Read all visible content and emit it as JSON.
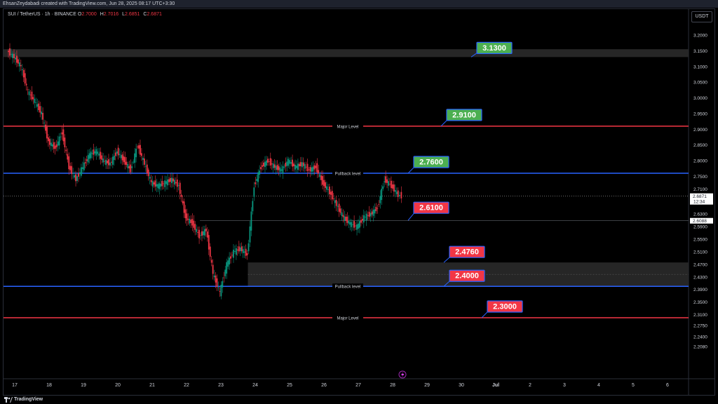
{
  "header": {
    "caption": "EhsanZeydabadi created with TradingView.com, Jun 28, 2025 08:17 UTC+3:30"
  },
  "legend": {
    "symbol": "SUI / TetherUS · 1h · BINANCE",
    "o_label": "O",
    "o_value": "2.7000",
    "h_label": "H",
    "h_value": "2.7016",
    "l_label": "L",
    "l_value": "2.6851",
    "c_label": "C",
    "c_value": "2.6871"
  },
  "currency_button": "USDT",
  "footer": {
    "brand": "TradingView"
  },
  "colors": {
    "background": "#000000",
    "candle_up": "#089981",
    "candle_down": "#f23645",
    "major_level": "#f23645",
    "pullback_level": "#2962ff",
    "green_box": "#4caf50",
    "red_box": "#f23645"
  },
  "chart_data": {
    "type": "candlestick",
    "title": "SUI / TetherUS · 1h · BINANCE",
    "ylim": [
      2.2,
      3.24
    ],
    "y_ticks": [
      "3.2000",
      "3.1500",
      "3.1000",
      "3.0500",
      "3.0000",
      "2.9500",
      "2.9000",
      "2.8500",
      "2.8000",
      "2.7500",
      "2.7100",
      "2.6300",
      "2.5900",
      "2.5500",
      "2.5100",
      "2.4700",
      "2.4300",
      "2.3900",
      "2.3500",
      "2.3100",
      "2.2750",
      "2.2400",
      "2.2080"
    ],
    "x_ticks": [
      "17",
      "18",
      "19",
      "20",
      "21",
      "22",
      "23",
      "24",
      "25",
      "26",
      "27",
      "28",
      "29",
      "30",
      "Jul",
      "2",
      "3",
      "4",
      "5",
      "6"
    ],
    "price_tags": [
      {
        "price": "2.6871",
        "time": "12:34",
        "value": 2.6871
      },
      {
        "price": "2.6088",
        "value": 2.6088
      }
    ],
    "levels": [
      {
        "label": "Major Level",
        "value": 2.91,
        "kind": "major"
      },
      {
        "label": "Pullback level",
        "value": 2.76,
        "kind": "pullback"
      },
      {
        "label": "Pullback level",
        "value": 2.4,
        "kind": "pullback"
      },
      {
        "label": "Major Level",
        "value": 2.3,
        "kind": "major"
      }
    ],
    "zones": [
      {
        "from": 3.13,
        "to": 3.155
      },
      {
        "from": 2.4,
        "to": 2.476
      }
    ],
    "annotations": [
      {
        "text": "3.1300",
        "value": 3.13,
        "kind": "green"
      },
      {
        "text": "2.9100",
        "value": 2.91,
        "kind": "green"
      },
      {
        "text": "2.7600",
        "value": 2.76,
        "kind": "green"
      },
      {
        "text": "2.6100",
        "value": 2.61,
        "kind": "red"
      },
      {
        "text": "2.4760",
        "value": 2.476,
        "kind": "red"
      },
      {
        "text": "2.4000",
        "value": 2.4,
        "kind": "red"
      },
      {
        "text": "2.3000",
        "value": 2.3,
        "kind": "red"
      }
    ],
    "series": [
      {
        "day": 17.0,
        "close": 3.13
      },
      {
        "day": 17.2,
        "close": 3.1
      },
      {
        "day": 17.4,
        "close": 3.02
      },
      {
        "day": 17.6,
        "close": 2.99
      },
      {
        "day": 17.8,
        "close": 2.95
      },
      {
        "day": 18.0,
        "close": 2.86
      },
      {
        "day": 18.2,
        "close": 2.84
      },
      {
        "day": 18.4,
        "close": 2.89
      },
      {
        "day": 18.6,
        "close": 2.78
      },
      {
        "day": 18.8,
        "close": 2.74
      },
      {
        "day": 19.0,
        "close": 2.78
      },
      {
        "day": 19.2,
        "close": 2.82
      },
      {
        "day": 19.4,
        "close": 2.83
      },
      {
        "day": 19.6,
        "close": 2.8
      },
      {
        "day": 19.8,
        "close": 2.79
      },
      {
        "day": 20.0,
        "close": 2.83
      },
      {
        "day": 20.2,
        "close": 2.8
      },
      {
        "day": 20.4,
        "close": 2.77
      },
      {
        "day": 20.6,
        "close": 2.85
      },
      {
        "day": 20.8,
        "close": 2.79
      },
      {
        "day": 21.0,
        "close": 2.73
      },
      {
        "day": 21.2,
        "close": 2.72
      },
      {
        "day": 21.4,
        "close": 2.73
      },
      {
        "day": 21.6,
        "close": 2.74
      },
      {
        "day": 21.8,
        "close": 2.72
      },
      {
        "day": 22.0,
        "close": 2.62
      },
      {
        "day": 22.2,
        "close": 2.6
      },
      {
        "day": 22.4,
        "close": 2.56
      },
      {
        "day": 22.6,
        "close": 2.58
      },
      {
        "day": 22.8,
        "close": 2.44
      },
      {
        "day": 23.0,
        "close": 2.38
      },
      {
        "day": 23.2,
        "close": 2.47
      },
      {
        "day": 23.4,
        "close": 2.51
      },
      {
        "day": 23.6,
        "close": 2.52
      },
      {
        "day": 23.8,
        "close": 2.5
      },
      {
        "day": 24.0,
        "close": 2.72
      },
      {
        "day": 24.2,
        "close": 2.78
      },
      {
        "day": 24.4,
        "close": 2.8
      },
      {
        "day": 24.6,
        "close": 2.78
      },
      {
        "day": 24.8,
        "close": 2.77
      },
      {
        "day": 25.0,
        "close": 2.8
      },
      {
        "day": 25.2,
        "close": 2.78
      },
      {
        "day": 25.4,
        "close": 2.79
      },
      {
        "day": 25.6,
        "close": 2.77
      },
      {
        "day": 25.8,
        "close": 2.78
      },
      {
        "day": 26.0,
        "close": 2.73
      },
      {
        "day": 26.2,
        "close": 2.7
      },
      {
        "day": 26.4,
        "close": 2.66
      },
      {
        "day": 26.6,
        "close": 2.62
      },
      {
        "day": 26.8,
        "close": 2.6
      },
      {
        "day": 27.0,
        "close": 2.59
      },
      {
        "day": 27.2,
        "close": 2.62
      },
      {
        "day": 27.4,
        "close": 2.63
      },
      {
        "day": 27.6,
        "close": 2.65
      },
      {
        "day": 27.8,
        "close": 2.74
      },
      {
        "day": 28.0,
        "close": 2.72
      },
      {
        "day": 28.2,
        "close": 2.69
      },
      {
        "day": 28.3,
        "close": 2.6871
      }
    ]
  }
}
